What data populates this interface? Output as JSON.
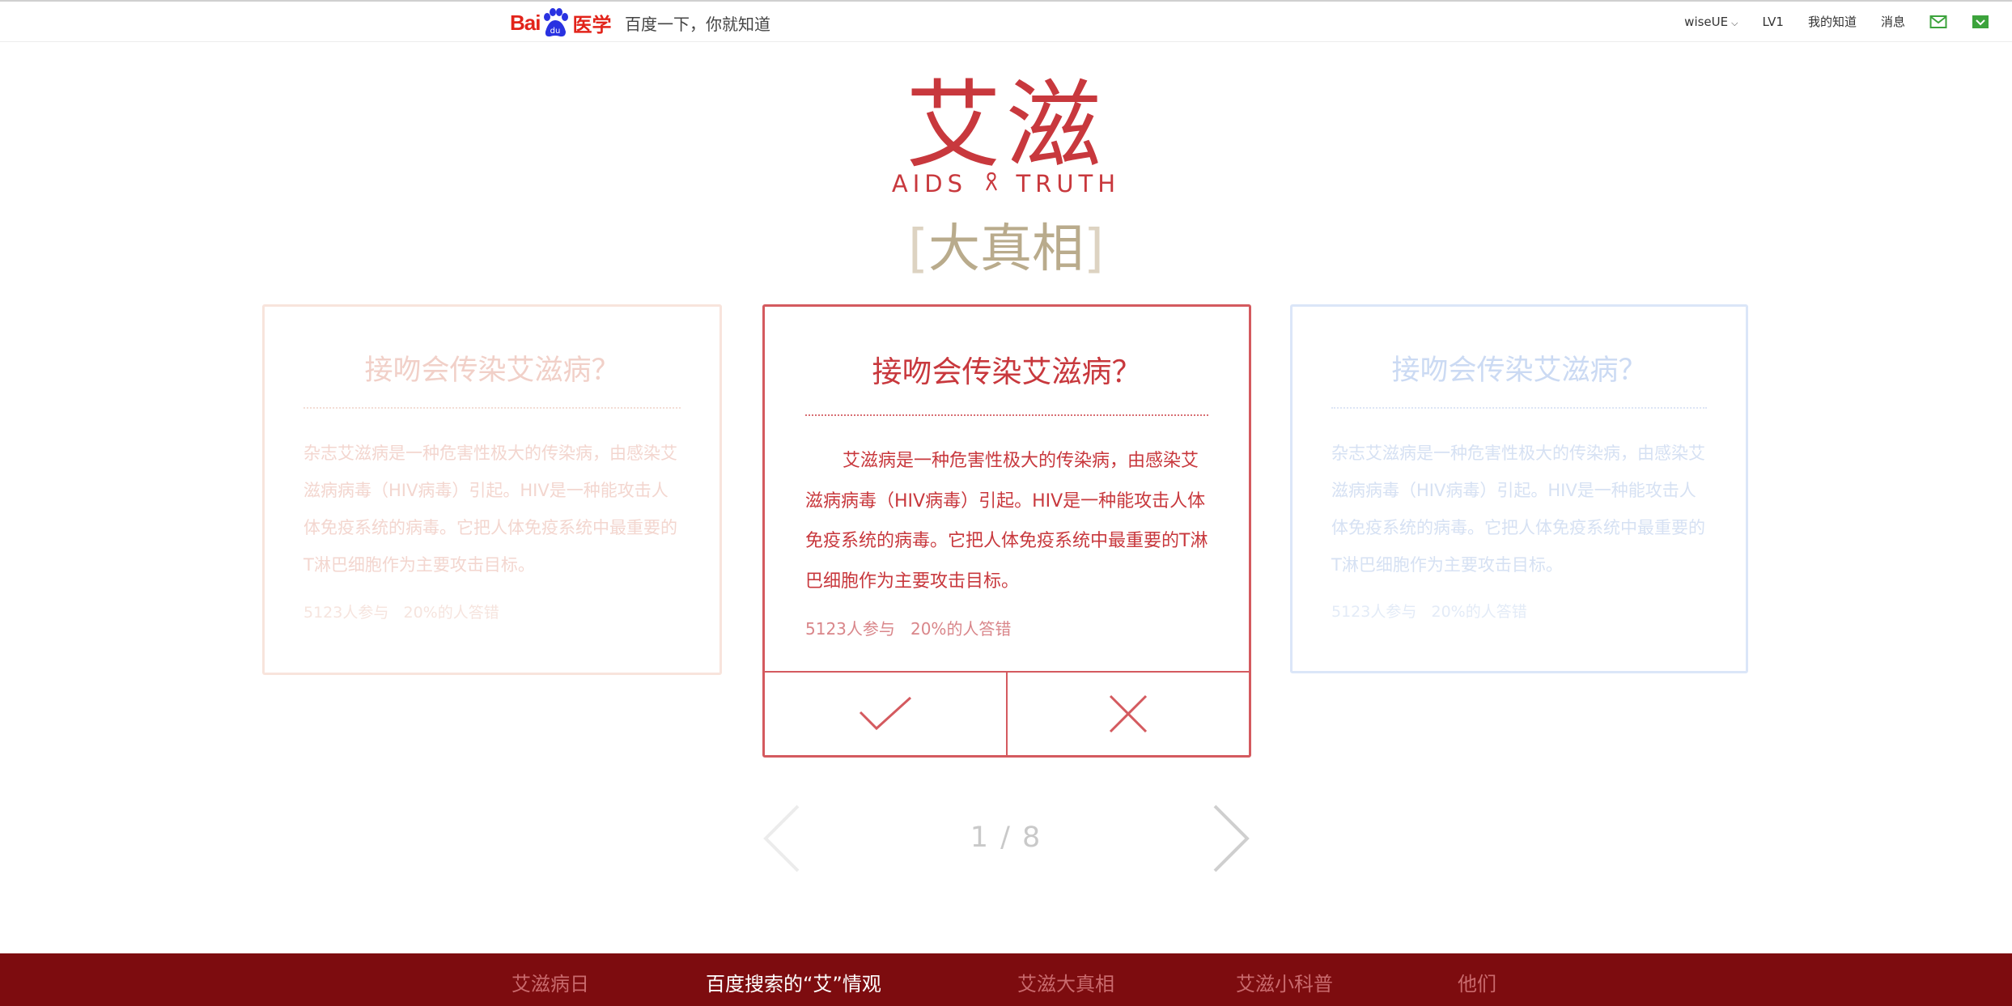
{
  "header": {
    "logo_text_left": "Bai",
    "logo_text_paw": "du",
    "logo_text_right": "医学",
    "slogan": "百度一下，你就知道",
    "user": "wiseUE",
    "level": "LV1",
    "my_zhidao": "我的知道",
    "messages": "消息",
    "icons": [
      "mail-icon",
      "download-icon"
    ]
  },
  "hero": {
    "title": "艾滋",
    "subtitle_left": "AIDS",
    "subtitle_right": "TRUTH",
    "tag_open": "[",
    "tag": "大真相",
    "tag_close": "]"
  },
  "cards": {
    "left": {
      "question": "接吻会传染艾滋病？",
      "body": "杂志艾滋病是一种危害性极大的传染病，由感染艾滋病病毒（HIV病毒）引起。HIV是一种能攻击人体免疫系统的病毒。它把人体免疫系统中最重要的T淋巴细胞作为主要攻击目标。",
      "participants": "5123人参与",
      "wrong_rate": "20%的人答错"
    },
    "main": {
      "question": "接吻会传染艾滋病？",
      "body": "艾滋病是一种危害性极大的传染病，由感染艾滋病病毒（HIV病毒）引起。HIV是一种能攻击人体免疫系统的病毒。它把人体免疫系统中最重要的T淋巴细胞作为主要攻击目标。",
      "participants": "5123人参与",
      "wrong_rate": "20%的人答错"
    },
    "right": {
      "question": "接吻会传染艾滋病？",
      "body": "杂志艾滋病是一种危害性极大的传染病，由感染艾滋病病毒（HIV病毒）引起。HIV是一种能攻击人体免疫系统的病毒。它把人体免疫系统中最重要的T淋巴细胞作为主要攻击目标。",
      "participants": "5123人参与",
      "wrong_rate": "20%的人答错"
    }
  },
  "pager": {
    "current": "1",
    "sep": " / ",
    "total": "8"
  },
  "footer": {
    "tabs": [
      "艾滋病日",
      "百度搜索的“艾”情观",
      "艾滋大真相",
      "艾滋小科普",
      "他们"
    ],
    "active_index": 1
  },
  "colors": {
    "accent": "#c8383d",
    "footer_bg": "#7d0c0f",
    "tag_gold": "#b9ab8c"
  }
}
